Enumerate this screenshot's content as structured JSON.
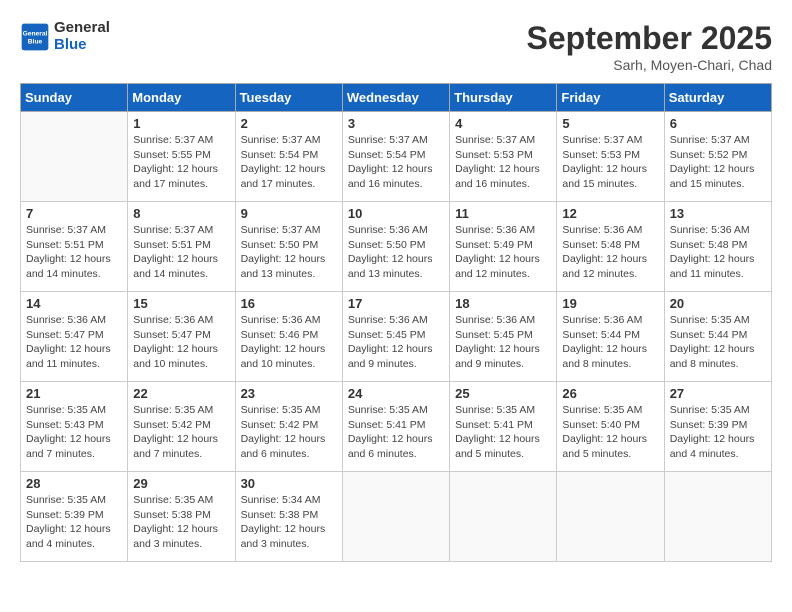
{
  "header": {
    "logo_line1": "General",
    "logo_line2": "Blue",
    "month": "September 2025",
    "location": "Sarh, Moyen-Chari, Chad"
  },
  "days_of_week": [
    "Sunday",
    "Monday",
    "Tuesday",
    "Wednesday",
    "Thursday",
    "Friday",
    "Saturday"
  ],
  "weeks": [
    [
      {
        "day": "",
        "info": ""
      },
      {
        "day": "1",
        "info": "Sunrise: 5:37 AM\nSunset: 5:55 PM\nDaylight: 12 hours\nand 17 minutes."
      },
      {
        "day": "2",
        "info": "Sunrise: 5:37 AM\nSunset: 5:54 PM\nDaylight: 12 hours\nand 17 minutes."
      },
      {
        "day": "3",
        "info": "Sunrise: 5:37 AM\nSunset: 5:54 PM\nDaylight: 12 hours\nand 16 minutes."
      },
      {
        "day": "4",
        "info": "Sunrise: 5:37 AM\nSunset: 5:53 PM\nDaylight: 12 hours\nand 16 minutes."
      },
      {
        "day": "5",
        "info": "Sunrise: 5:37 AM\nSunset: 5:53 PM\nDaylight: 12 hours\nand 15 minutes."
      },
      {
        "day": "6",
        "info": "Sunrise: 5:37 AM\nSunset: 5:52 PM\nDaylight: 12 hours\nand 15 minutes."
      }
    ],
    [
      {
        "day": "7",
        "info": "Sunrise: 5:37 AM\nSunset: 5:51 PM\nDaylight: 12 hours\nand 14 minutes."
      },
      {
        "day": "8",
        "info": "Sunrise: 5:37 AM\nSunset: 5:51 PM\nDaylight: 12 hours\nand 14 minutes."
      },
      {
        "day": "9",
        "info": "Sunrise: 5:37 AM\nSunset: 5:50 PM\nDaylight: 12 hours\nand 13 minutes."
      },
      {
        "day": "10",
        "info": "Sunrise: 5:36 AM\nSunset: 5:50 PM\nDaylight: 12 hours\nand 13 minutes."
      },
      {
        "day": "11",
        "info": "Sunrise: 5:36 AM\nSunset: 5:49 PM\nDaylight: 12 hours\nand 12 minutes."
      },
      {
        "day": "12",
        "info": "Sunrise: 5:36 AM\nSunset: 5:48 PM\nDaylight: 12 hours\nand 12 minutes."
      },
      {
        "day": "13",
        "info": "Sunrise: 5:36 AM\nSunset: 5:48 PM\nDaylight: 12 hours\nand 11 minutes."
      }
    ],
    [
      {
        "day": "14",
        "info": "Sunrise: 5:36 AM\nSunset: 5:47 PM\nDaylight: 12 hours\nand 11 minutes."
      },
      {
        "day": "15",
        "info": "Sunrise: 5:36 AM\nSunset: 5:47 PM\nDaylight: 12 hours\nand 10 minutes."
      },
      {
        "day": "16",
        "info": "Sunrise: 5:36 AM\nSunset: 5:46 PM\nDaylight: 12 hours\nand 10 minutes."
      },
      {
        "day": "17",
        "info": "Sunrise: 5:36 AM\nSunset: 5:45 PM\nDaylight: 12 hours\nand 9 minutes."
      },
      {
        "day": "18",
        "info": "Sunrise: 5:36 AM\nSunset: 5:45 PM\nDaylight: 12 hours\nand 9 minutes."
      },
      {
        "day": "19",
        "info": "Sunrise: 5:36 AM\nSunset: 5:44 PM\nDaylight: 12 hours\nand 8 minutes."
      },
      {
        "day": "20",
        "info": "Sunrise: 5:35 AM\nSunset: 5:44 PM\nDaylight: 12 hours\nand 8 minutes."
      }
    ],
    [
      {
        "day": "21",
        "info": "Sunrise: 5:35 AM\nSunset: 5:43 PM\nDaylight: 12 hours\nand 7 minutes."
      },
      {
        "day": "22",
        "info": "Sunrise: 5:35 AM\nSunset: 5:42 PM\nDaylight: 12 hours\nand 7 minutes."
      },
      {
        "day": "23",
        "info": "Sunrise: 5:35 AM\nSunset: 5:42 PM\nDaylight: 12 hours\nand 6 minutes."
      },
      {
        "day": "24",
        "info": "Sunrise: 5:35 AM\nSunset: 5:41 PM\nDaylight: 12 hours\nand 6 minutes."
      },
      {
        "day": "25",
        "info": "Sunrise: 5:35 AM\nSunset: 5:41 PM\nDaylight: 12 hours\nand 5 minutes."
      },
      {
        "day": "26",
        "info": "Sunrise: 5:35 AM\nSunset: 5:40 PM\nDaylight: 12 hours\nand 5 minutes."
      },
      {
        "day": "27",
        "info": "Sunrise: 5:35 AM\nSunset: 5:39 PM\nDaylight: 12 hours\nand 4 minutes."
      }
    ],
    [
      {
        "day": "28",
        "info": "Sunrise: 5:35 AM\nSunset: 5:39 PM\nDaylight: 12 hours\nand 4 minutes."
      },
      {
        "day": "29",
        "info": "Sunrise: 5:35 AM\nSunset: 5:38 PM\nDaylight: 12 hours\nand 3 minutes."
      },
      {
        "day": "30",
        "info": "Sunrise: 5:34 AM\nSunset: 5:38 PM\nDaylight: 12 hours\nand 3 minutes."
      },
      {
        "day": "",
        "info": ""
      },
      {
        "day": "",
        "info": ""
      },
      {
        "day": "",
        "info": ""
      },
      {
        "day": "",
        "info": ""
      }
    ]
  ]
}
